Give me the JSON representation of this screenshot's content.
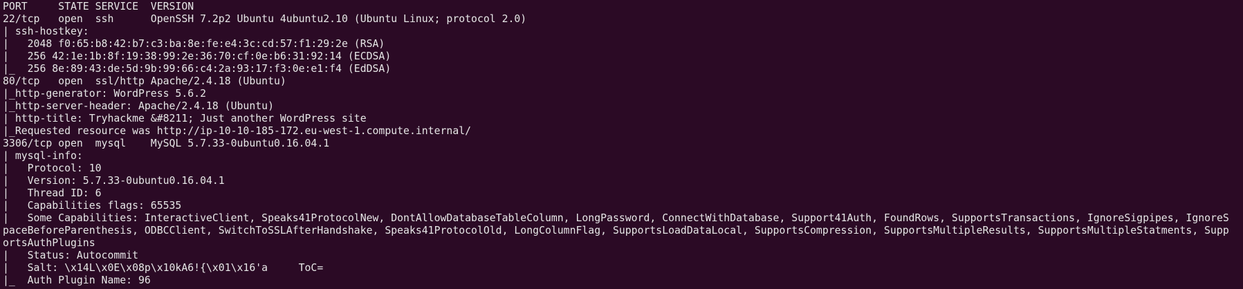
{
  "terminal": {
    "lines": [
      "PORT     STATE SERVICE  VERSION",
      "22/tcp   open  ssh      OpenSSH 7.2p2 Ubuntu 4ubuntu2.10 (Ubuntu Linux; protocol 2.0)",
      "| ssh-hostkey:",
      "|   2048 f0:65:b8:42:b7:c3:ba:8e:fe:e4:3c:cd:57:f1:29:2e (RSA)",
      "|   256 42:1e:1b:8f:19:38:99:2e:36:70:cf:0e:b6:31:92:14 (ECDSA)",
      "|_  256 8e:89:43:de:5d:9b:99:66:c4:2a:93:17:f3:0e:e1:f4 (EdDSA)",
      "80/tcp   open  ssl/http Apache/2.4.18 (Ubuntu)",
      "|_http-generator: WordPress 5.6.2",
      "|_http-server-header: Apache/2.4.18 (Ubuntu)",
      "| http-title: Tryhackme &#8211; Just another WordPress site",
      "|_Requested resource was http://ip-10-10-185-172.eu-west-1.compute.internal/",
      "3306/tcp open  mysql    MySQL 5.7.33-0ubuntu0.16.04.1",
      "| mysql-info:",
      "|   Protocol: 10",
      "|   Version: 5.7.33-0ubuntu0.16.04.1",
      "|   Thread ID: 6",
      "|   Capabilities flags: 65535",
      "|   Some Capabilities: InteractiveClient, Speaks41ProtocolNew, DontAllowDatabaseTableColumn, LongPassword, ConnectWithDatabase, Support41Auth, FoundRows, SupportsTransactions, IgnoreSigpipes, IgnoreS",
      "paceBeforeParenthesis, ODBCClient, SwitchToSSLAfterHandshake, Speaks41ProtocolOld, LongColumnFlag, SupportsLoadDataLocal, SupportsCompression, SupportsMultipleResults, SupportsMultipleStatments, Supp",
      "ortsAuthPlugins",
      "|   Status: Autocommit",
      "|   Salt: \\x14L\\x0E\\x08p\\x10kA6!{\\x01\\x16'a     ToC=",
      "|_  Auth Plugin Name: 96"
    ]
  }
}
